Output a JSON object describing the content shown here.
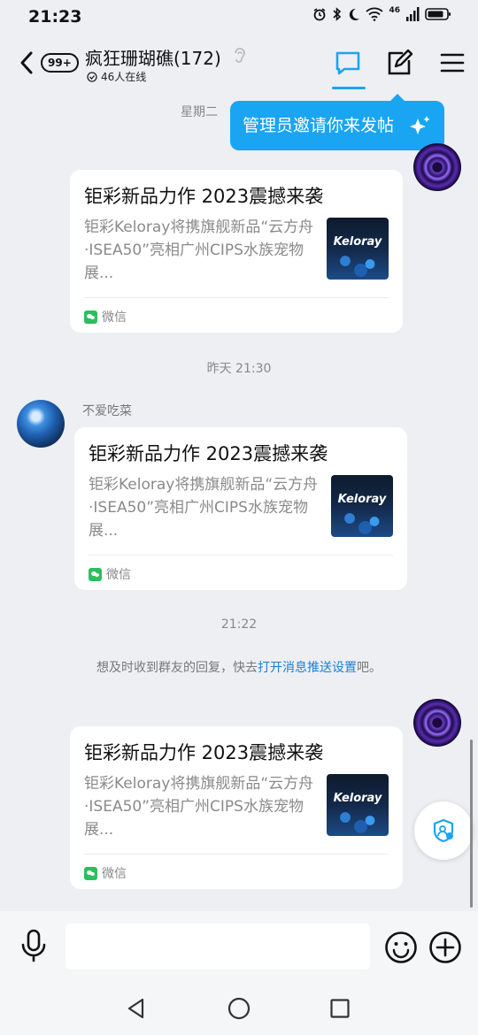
{
  "status_bar": {
    "time": "21:23",
    "network": "46",
    "icons": [
      "alarm-icon",
      "bluetooth-icon",
      "moon-icon",
      "wifi-icon",
      "signal-icon",
      "battery-icon"
    ]
  },
  "header": {
    "unread_count": "99+",
    "group_name": "疯狂珊瑚礁(172)",
    "online_text": "46人在线",
    "icons": [
      "back-icon",
      "ear-icon",
      "chat-bubble-icon",
      "edit-post-icon",
      "menu-icon"
    ],
    "accent_color": "#1aa5f2"
  },
  "tooltip": {
    "text": "管理员邀请你来发帖"
  },
  "timestamps": {
    "first": "星期二",
    "second": "昨天 21:30",
    "third": "21:22"
  },
  "messages": [
    {
      "sender": "",
      "card": {
        "title": "钜彩新品力作 2023震撼来袭",
        "description": "钜彩Keloray将携旗舰新品“云方舟·ISEA50”亮相广州CIPS水族宠物展...",
        "thumb_logo": "Keloray",
        "source": "微信"
      }
    },
    {
      "sender": "不爱吃菜",
      "card": {
        "title": "钜彩新品力作 2023震撼来袭",
        "description": "钜彩Keloray将携旗舰新品“云方舟·ISEA50”亮相广州CIPS水族宠物展...",
        "thumb_logo": "Keloray",
        "source": "微信"
      }
    },
    {
      "sender": "",
      "card": {
        "title": "钜彩新品力作 2023震撼来袭",
        "description": "钜彩Keloray将携旗舰新品“云方舟·ISEA50”亮相广州CIPS水族宠物展...",
        "thumb_logo": "Keloray",
        "source": "微信"
      }
    }
  ],
  "notice": {
    "prefix": "想及时收到群友的回复，快去",
    "link": "打开消息推送设置",
    "suffix": "吧。"
  },
  "input_bar": {
    "placeholder": "",
    "icons": [
      "microphone-icon",
      "emoji-icon",
      "plus-icon"
    ]
  },
  "nav_bar": {
    "icons": [
      "nav-back-icon",
      "nav-home-icon",
      "nav-recent-icon"
    ]
  }
}
